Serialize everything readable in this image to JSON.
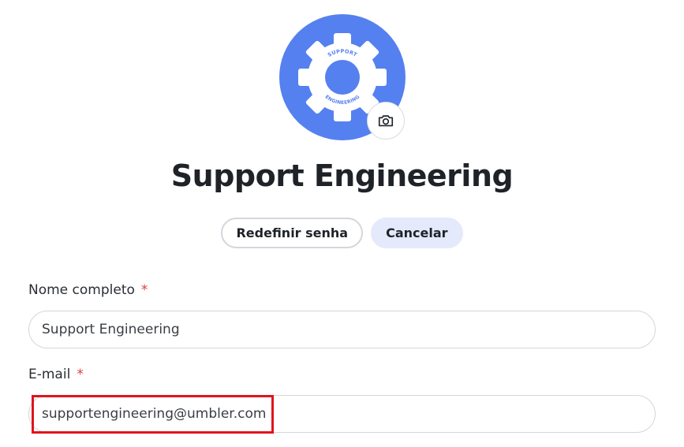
{
  "profile": {
    "avatar_icon": "gear-icon",
    "avatar_text_top": "SUPPORT",
    "avatar_text_bottom": "ENGINEERING",
    "avatar_color": "#5580f0",
    "camera_icon": "camera-icon",
    "name": "Support Engineering"
  },
  "actions": {
    "reset_password_label": "Redefinir senha",
    "cancel_label": "Cancelar"
  },
  "form": {
    "full_name": {
      "label": "Nome completo",
      "required_mark": "*",
      "value": "Support Engineering"
    },
    "email": {
      "label": "E-mail",
      "required_mark": "*",
      "value": "supportengineering@umbler.com"
    }
  },
  "colors": {
    "accent": "#5580f0",
    "required": "#e03b3b",
    "highlight": "#e0141e",
    "soft_button": "#e4e9fb"
  }
}
